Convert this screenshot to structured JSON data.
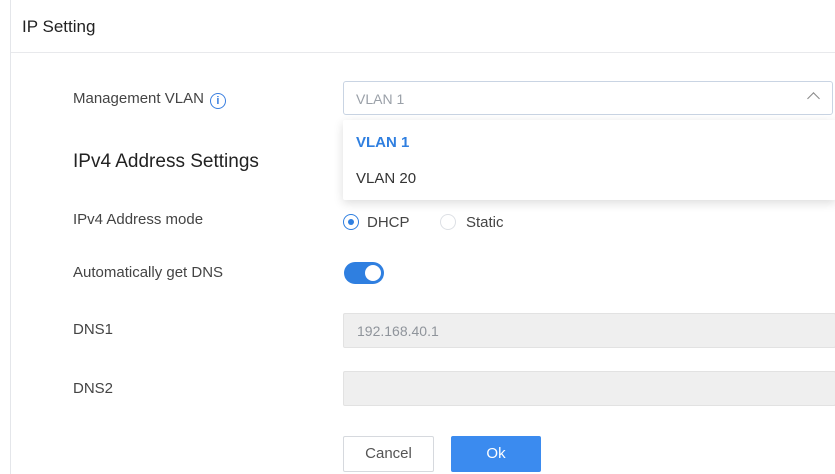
{
  "header": {
    "title": "IP Setting"
  },
  "management_vlan": {
    "label": "Management VLAN",
    "info_icon": "info-icon",
    "selected": "VLAN 1",
    "options": [
      "VLAN 1",
      "VLAN 20"
    ]
  },
  "ipv4": {
    "section_title": "IPv4 Address Settings",
    "mode_label": "IPv4 Address mode",
    "mode_options": [
      "DHCP",
      "Static"
    ],
    "mode_selected": "DHCP"
  },
  "auto_dns": {
    "label": "Automatically get DNS",
    "enabled": true
  },
  "dns1": {
    "label": "DNS1",
    "value": "192.168.40.1"
  },
  "dns2": {
    "label": "DNS2",
    "value": ""
  },
  "buttons": {
    "cancel": "Cancel",
    "ok": "Ok"
  },
  "colors": {
    "accent": "#2f7fe0",
    "ok_button": "#3b8bef",
    "disabled_field": "#efefef"
  }
}
